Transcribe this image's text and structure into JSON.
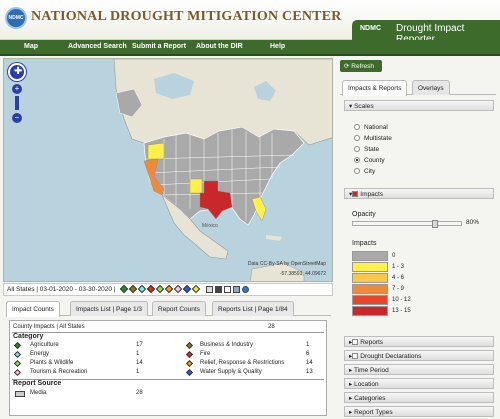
{
  "header": {
    "logo_text": "NDMC",
    "org_name": "NATIONAL DROUGHT MITIGATION CENTER",
    "app_abbr": "NDMC",
    "app_name": "Drought Impact Reporter"
  },
  "nav": [
    "Map",
    "Advanced Search",
    "Submit a Report",
    "About the DIR",
    "Help"
  ],
  "map": {
    "label_mexico": "México",
    "attribution": "Data CC-By-SA by OpenStreetMap",
    "coords": "-57.38593, 44.09672",
    "zoom_in": "+",
    "zoom_out": "−"
  },
  "filter_summary": "All States  |  03-01-2020 - 03-30-2020  |",
  "tabs": [
    "Impact Counts",
    "Impacts List | Page 1/3",
    "Report Counts",
    "Reports List | Page 1/84"
  ],
  "counts": {
    "heading": "County Impacts | All States",
    "total": "28",
    "category_heading": "Category",
    "categories": [
      {
        "name": "Agriculture",
        "count": "17",
        "color": "#2a8a2a"
      },
      {
        "name": "Energy",
        "count": "1",
        "color": "#7fe7e0"
      },
      {
        "name": "Plants & Wildlife",
        "count": "14",
        "color": "#9bd35a"
      },
      {
        "name": "Tourism & Recreation",
        "count": "1",
        "color": "#f3c6dd"
      },
      {
        "name": "Business & Industry",
        "count": "1",
        "color": "#8a7a1a"
      },
      {
        "name": "Fire",
        "count": "6",
        "color": "#e02a1a"
      },
      {
        "name": "Relief, Response & Restrictions",
        "count": "14",
        "color": "#f29a1a"
      },
      {
        "name": "Water Supply & Quality",
        "count": "13",
        "color": "#2a5ad8"
      }
    ],
    "source_heading": "Report Source",
    "sources": [
      {
        "name": "Media",
        "count": "28"
      }
    ]
  },
  "right": {
    "refresh": "Refresh",
    "tabs": [
      "Impacts & Reports",
      "Overlays"
    ],
    "scales_label": "Scales",
    "scales": [
      "National",
      "Multistate",
      "State",
      "County",
      "City"
    ],
    "selected_scale": "County",
    "impacts_label": "Impacts",
    "opacity_label": "Opacity",
    "opacity_value": "80%",
    "opacity_fraction": 0.8,
    "legend_title": "Impacts",
    "legend": [
      {
        "label": "0",
        "color": "#a9a9a9"
      },
      {
        "label": "1 - 3",
        "color": "#fff04a"
      },
      {
        "label": "4 - 6",
        "color": "#f7c84a"
      },
      {
        "label": "7 - 9",
        "color": "#f08a3a"
      },
      {
        "label": "10 - 12",
        "color": "#e8452a"
      },
      {
        "label": "13 - 15",
        "color": "#c8282a"
      }
    ],
    "sections": [
      "Reports",
      "Drought Declarations",
      "Time Period",
      "Location",
      "Categories",
      "Report Types"
    ]
  }
}
